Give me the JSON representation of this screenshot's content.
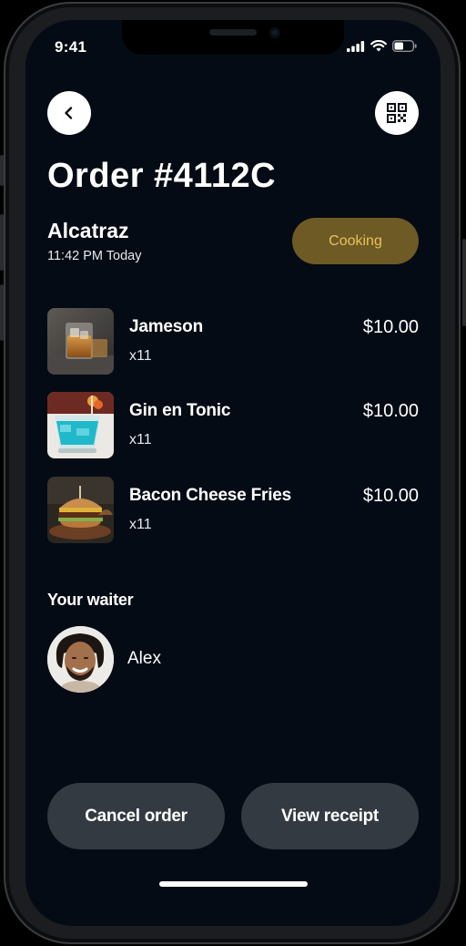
{
  "status_bar": {
    "time": "9:41"
  },
  "header": {
    "back_icon": "chevron-left-icon",
    "qr_icon": "qr-code-icon"
  },
  "order": {
    "title": "Order #4112C",
    "venue": "Alcatraz",
    "time": "11:42 PM Today",
    "status": "Cooking"
  },
  "items": [
    {
      "name": "Jameson",
      "qty": "x11",
      "price": "$10.00"
    },
    {
      "name": "Gin en Tonic",
      "qty": "x11",
      "price": "$10.00"
    },
    {
      "name": "Bacon Cheese Fries",
      "qty": "x11",
      "price": "$10.00"
    }
  ],
  "waiter": {
    "label": "Your waiter",
    "name": "Alex"
  },
  "actions": {
    "cancel": "Cancel order",
    "receipt": "View receipt"
  },
  "colors": {
    "background": "#050b14",
    "status_pill": "#6e5a24",
    "status_text": "#e8c25a",
    "button": "#343a42"
  }
}
